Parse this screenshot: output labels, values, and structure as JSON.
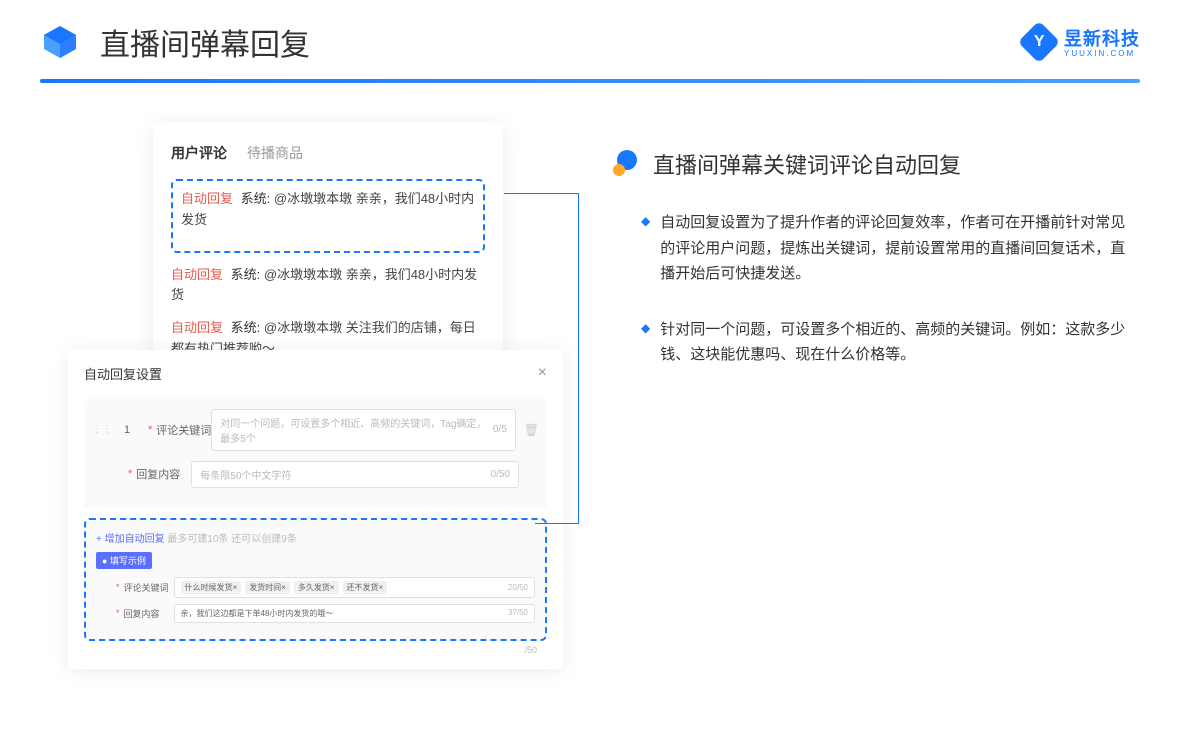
{
  "header": {
    "title": "直播间弹幕回复",
    "brand_name": "昱新科技",
    "brand_url": "YUUXIN.COM"
  },
  "comment_panel": {
    "tabs": {
      "active": "用户评论",
      "other": "待播商品"
    },
    "rows": [
      {
        "tag": "自动回复",
        "sys": "系统:",
        "text": "@冰墩墩本墩 亲亲，我们48小时内发货"
      },
      {
        "tag": "自动回复",
        "sys": "系统:",
        "text": "@冰墩墩本墩 亲亲，我们48小时内发货"
      },
      {
        "tag": "自动回复",
        "sys": "系统:",
        "text": "@冰墩墩本墩 关注我们的店铺，每日都有热门推荐哟～"
      }
    ]
  },
  "settings": {
    "title": "自动回复设置",
    "num": "1",
    "field1": {
      "label": "评论关键词",
      "placeholder": "对同一个问题，可设置多个相近、高频的关键词，Tag确定，最多5个",
      "count": "0/5"
    },
    "field2": {
      "label": "回复内容",
      "placeholder": "每条限50个中文字符",
      "count": "0/50"
    },
    "add_link": "+ 增加自动回复",
    "add_hint": "最多可建10条 还可以创建9条",
    "example_badge": "● 填写示例",
    "ex1": {
      "label": "评论关键词",
      "tags": [
        "什么时候发货×",
        "发货时间×",
        "多久发货×",
        "还不发货×"
      ],
      "count": "20/50"
    },
    "ex2": {
      "label": "回复内容",
      "text": "亲，我们这边都是下单48小时内发货的哦～",
      "count": "37/50"
    },
    "bottom_count": "/50"
  },
  "right": {
    "section_title": "直播间弹幕关键词评论自动回复",
    "bullets": [
      "自动回复设置为了提升作者的评论回复效率，作者可在开播前针对常见的评论用户问题，提炼出关键词，提前设置常用的直播间回复话术，直播开始后可快捷发送。",
      "针对同一个问题，可设置多个相近的、高频的关键词。例如：这款多少钱、这块能优惠吗、现在什么价格等。"
    ]
  }
}
